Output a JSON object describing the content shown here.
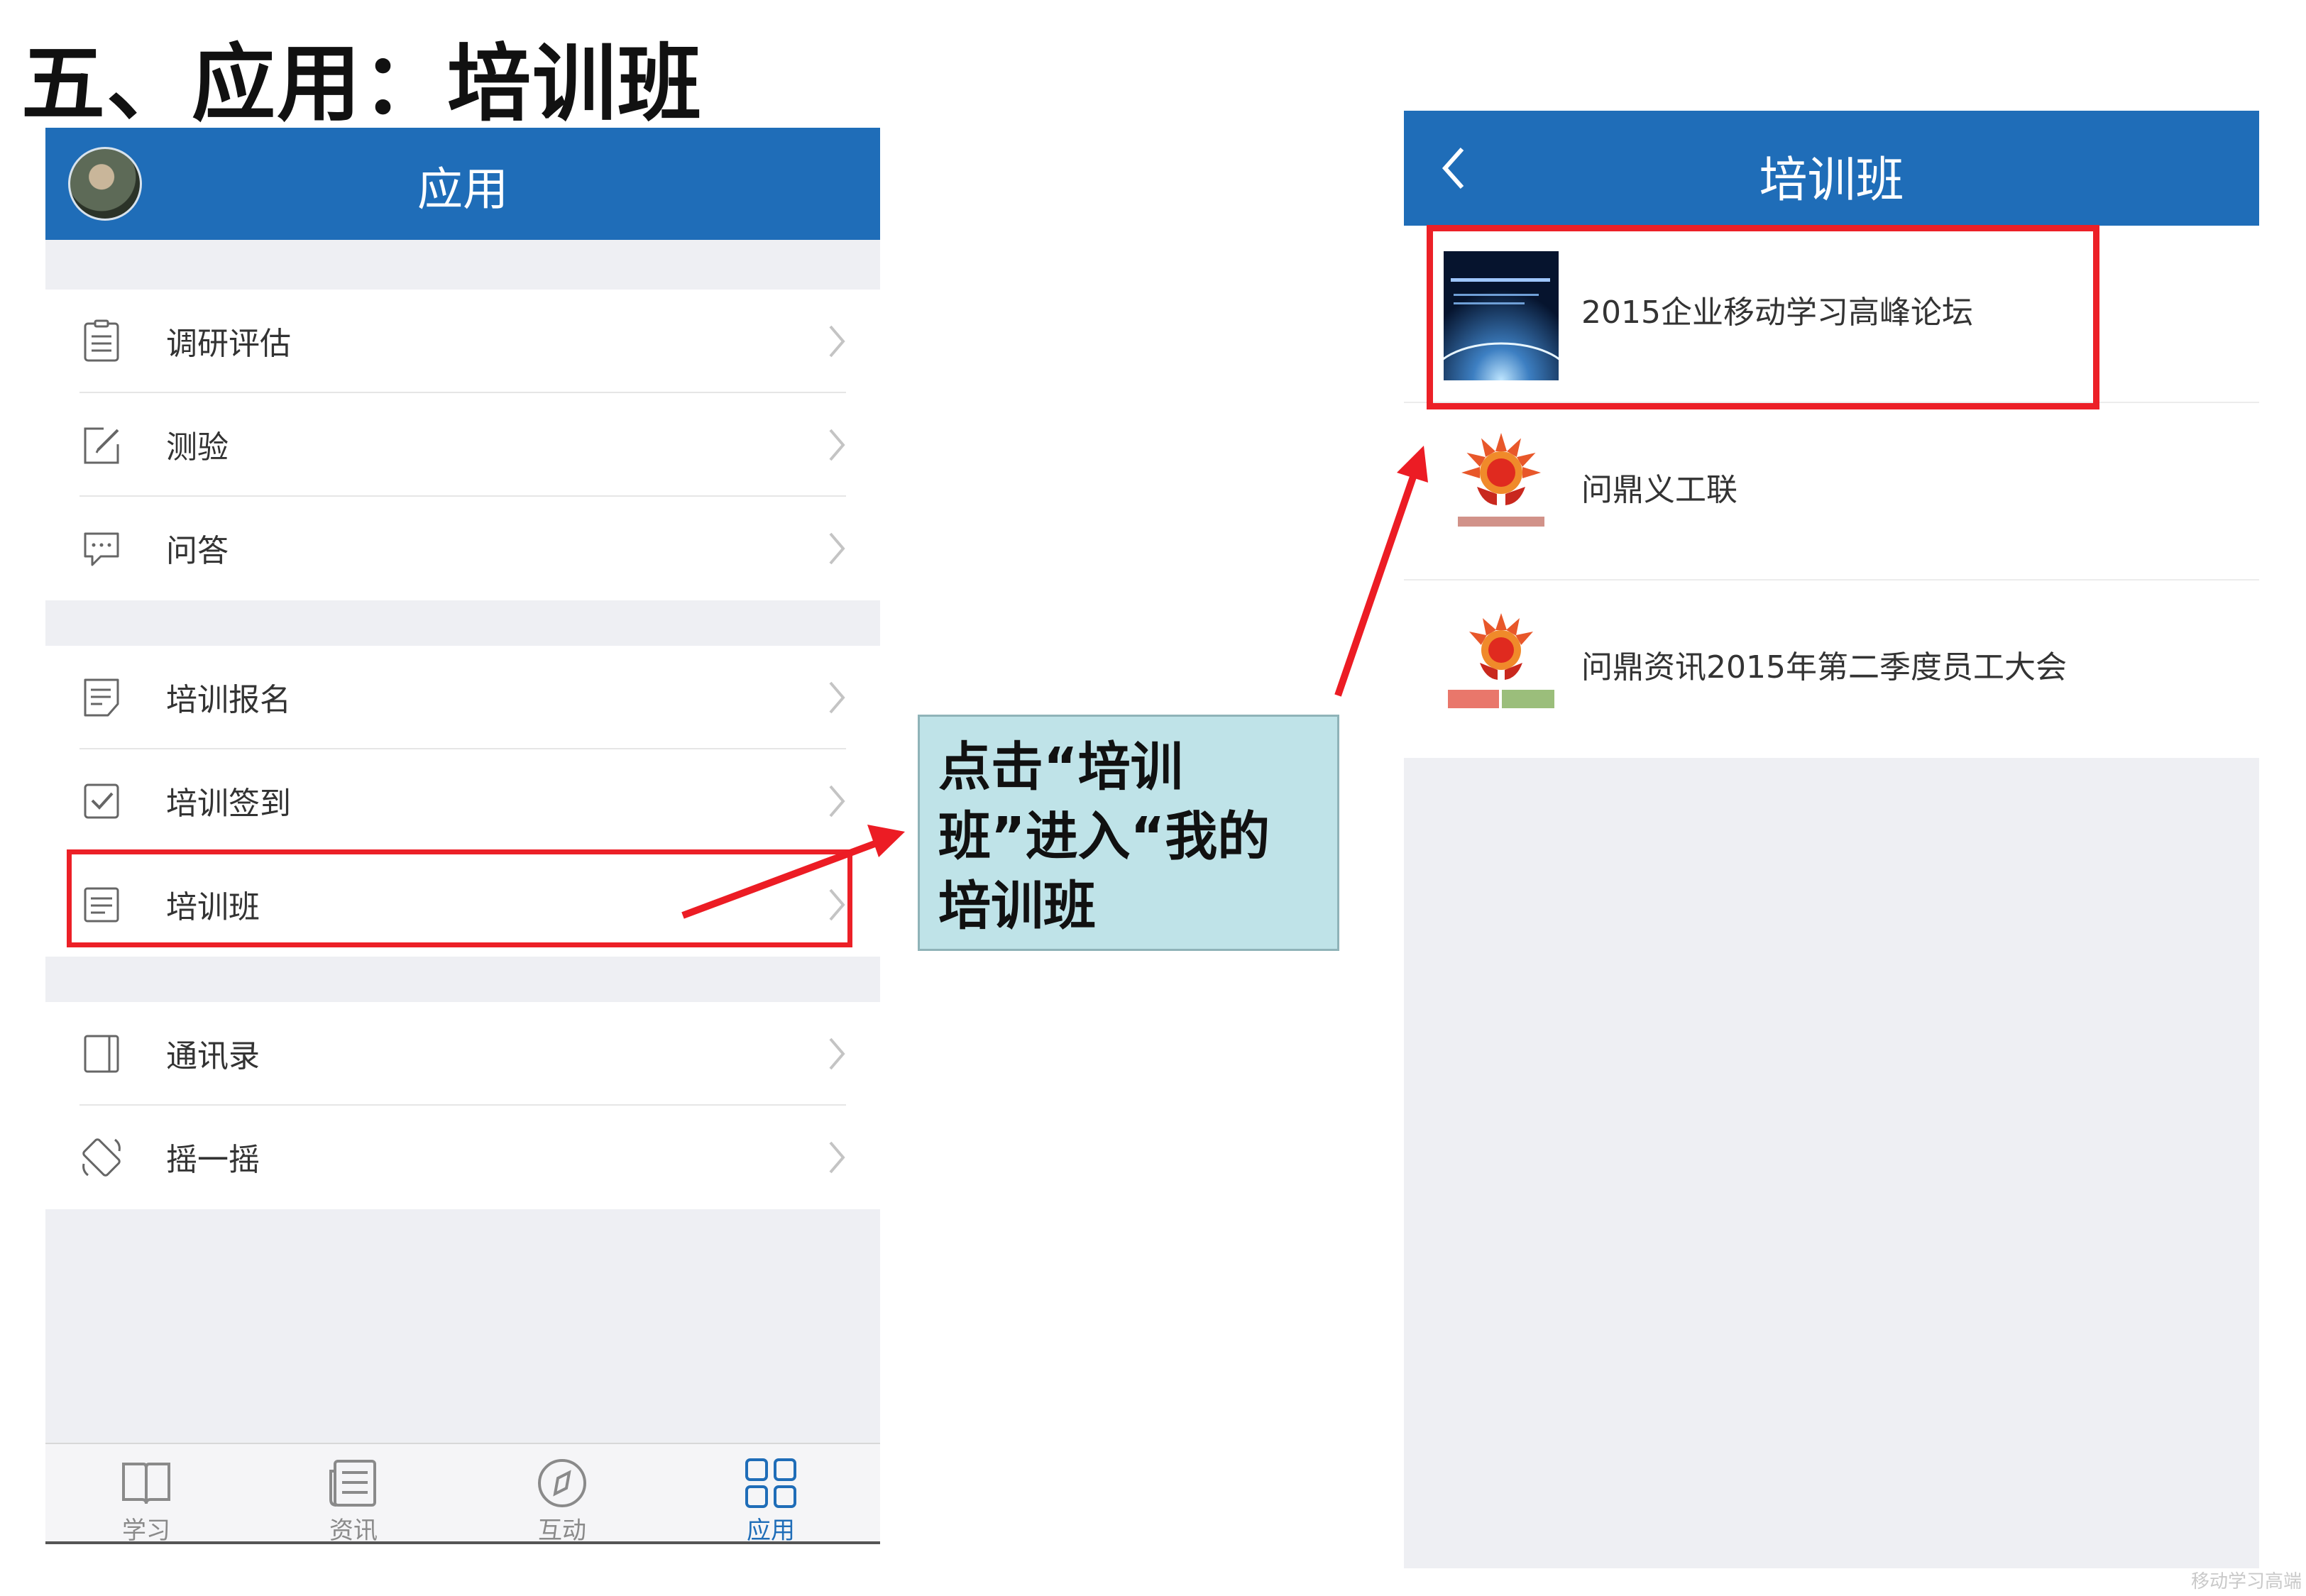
{
  "slide_title": "五、应用：培训班",
  "left_screen": {
    "header_title": "应用",
    "groups": [
      {
        "items": [
          {
            "label": "调研评估",
            "icon": "clipboard-list-icon"
          },
          {
            "label": "测验",
            "icon": "edit-pencil-icon"
          },
          {
            "label": "问答",
            "icon": "chat-bubble-icon"
          }
        ]
      },
      {
        "items": [
          {
            "label": "培训报名",
            "icon": "form-list-icon"
          },
          {
            "label": "培训签到",
            "icon": "checkbox-icon"
          },
          {
            "label": "培训班",
            "icon": "document-list-icon"
          }
        ]
      },
      {
        "items": [
          {
            "label": "通讯录",
            "icon": "contact-book-icon"
          },
          {
            "label": "摇一摇",
            "icon": "phone-shake-icon"
          }
        ]
      }
    ],
    "tabs": [
      {
        "label": "学习",
        "icon": "book-icon",
        "active": false
      },
      {
        "label": "资讯",
        "icon": "news-icon",
        "active": false
      },
      {
        "label": "互动",
        "icon": "compass-icon",
        "active": false
      },
      {
        "label": "应用",
        "icon": "grid-apps-icon",
        "active": true
      }
    ]
  },
  "callout": {
    "text": "点击“培训班”进入“我的培训班"
  },
  "right_screen": {
    "header_title": "培训班",
    "classes": [
      {
        "title": "2015企业移动学习高峰论坛",
        "thumb": "forum-cover-thumbnail"
      },
      {
        "title": "问鼎义工联",
        "thumb": "wending-volunteer-logo"
      },
      {
        "title": "问鼎资讯2015年第二季度员工大会",
        "thumb": "wending-news-logo"
      }
    ]
  },
  "colors": {
    "header_blue": "#1f6db8",
    "highlight_red": "#ec2027",
    "callout_bg": "#bfe3e8",
    "page_gray": "#eeeff3"
  },
  "watermark": "移动学习高端"
}
